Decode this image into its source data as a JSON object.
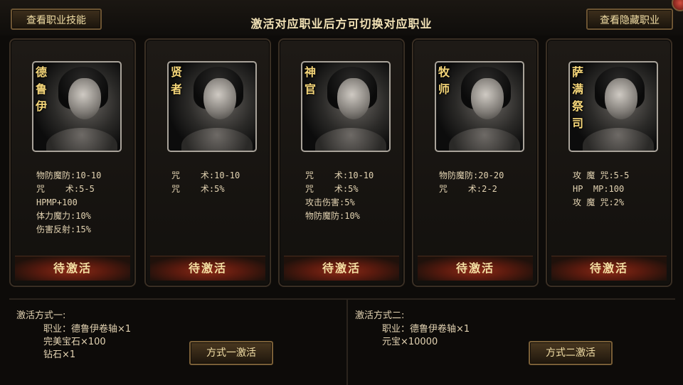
{
  "header": {
    "skills_button": "查看职业技能",
    "hidden_button": "查看隐藏职业",
    "headline": "激活对应职业后方可切换对应职业"
  },
  "classes": [
    {
      "name": "德鲁伊",
      "stats": [
        "物防魔防:10-10",
        "咒    术:5-5",
        "HPMP+100",
        "体力魔力:10%",
        "伤害反射:15%"
      ],
      "button": "待激活"
    },
    {
      "name": "贤者",
      "stats": [
        "咒    术:10-10",
        "咒    术:5%"
      ],
      "button": "待激活"
    },
    {
      "name": "神官",
      "stats": [
        "咒    术:10-10",
        "咒    术:5%",
        "攻击伤害:5%",
        "物防魔防:10%"
      ],
      "button": "待激活"
    },
    {
      "name": "牧师",
      "stats": [
        "物防魔防:20-20",
        "咒    术:2-2"
      ],
      "button": "待激活"
    },
    {
      "name": "萨满祭司",
      "stats": [
        "攻 魔 咒:5-5",
        "HP  MP:100",
        "攻 魔 咒:2%"
      ],
      "button": "待激活"
    }
  ],
  "methods": [
    {
      "title": "激活方式一:",
      "requirements": [
        "职业：德鲁伊卷轴×1",
        "完美宝石×100",
        "钻石×1"
      ],
      "button": "方式一激活"
    },
    {
      "title": "激活方式二:",
      "requirements": [
        "职业：德鲁伊卷轴×1",
        "元宝×10000"
      ],
      "button": "方式二激活"
    }
  ]
}
